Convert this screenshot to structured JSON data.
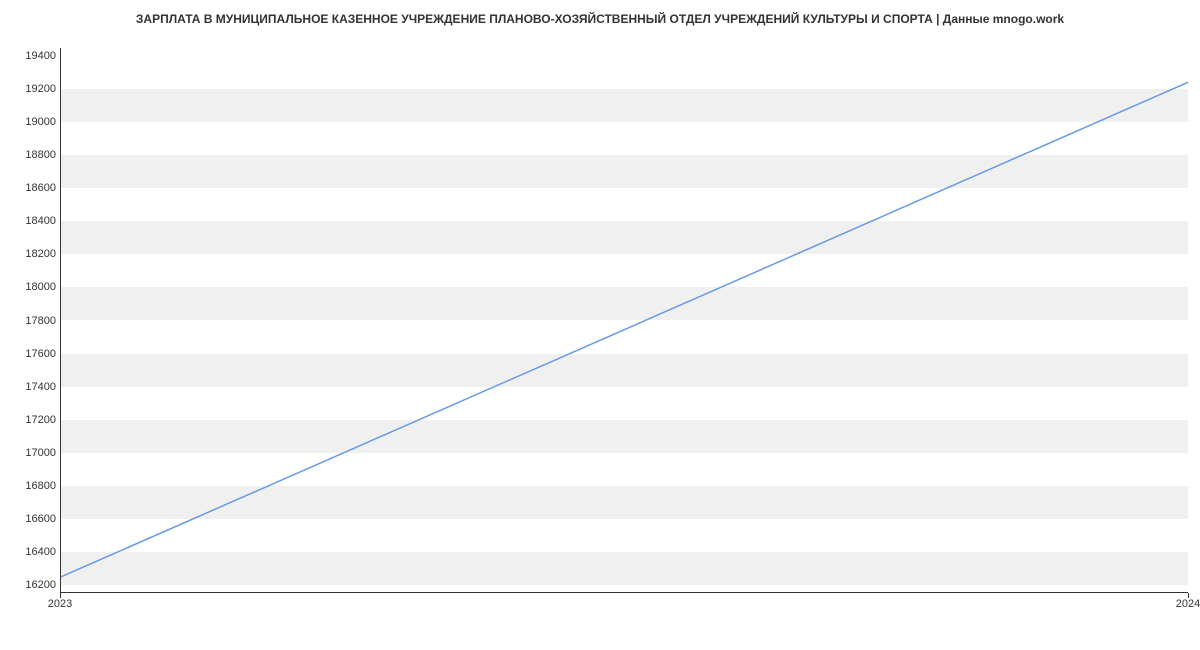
{
  "chart_data": {
    "type": "line",
    "title": "ЗАРПЛАТА В МУНИЦИПАЛЬНОЕ КАЗЕННОЕ УЧРЕЖДЕНИЕ ПЛАНОВО-ХОЗЯЙСТВЕННЫЙ ОТДЕЛ УЧРЕЖДЕНИЙ КУЛЬТУРЫ И СПОРТА | Данные mnogo.work",
    "x": [
      2023,
      2024
    ],
    "values": [
      16242,
      19242
    ],
    "xlabel": "",
    "ylabel": "",
    "x_ticks": [
      2023,
      2024
    ],
    "y_ticks": [
      16200,
      16400,
      16600,
      16800,
      17000,
      17200,
      17400,
      17600,
      17800,
      18000,
      18200,
      18400,
      18600,
      18800,
      19000,
      19200,
      19400
    ],
    "ylim": [
      16150,
      19450
    ],
    "xlim": [
      2023,
      2024
    ],
    "colors": {
      "line": "#6699e6",
      "band": "#f0f0f0"
    }
  }
}
